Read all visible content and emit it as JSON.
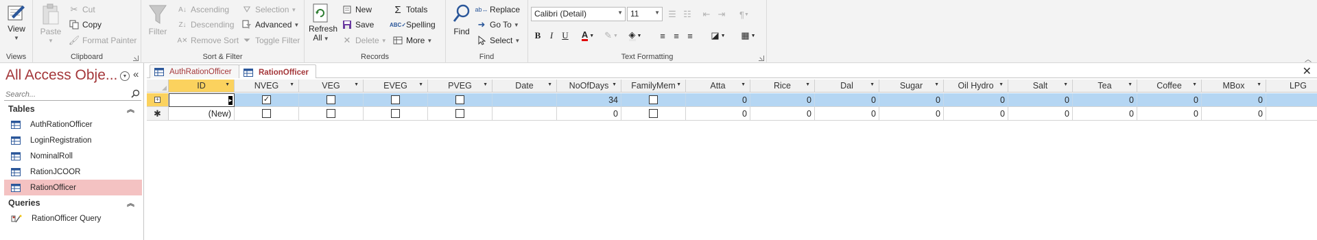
{
  "ribbon": {
    "groups": {
      "views": "Views",
      "clipboard": "Clipboard",
      "sort_filter": "Sort & Filter",
      "records": "Records",
      "find": "Find",
      "text_formatting": "Text Formatting"
    },
    "view": "View",
    "paste": "Paste",
    "cut": "Cut",
    "copy": "Copy",
    "format_painter": "Format Painter",
    "filter": "Filter",
    "ascending": "Ascending",
    "descending": "Descending",
    "remove_sort": "Remove Sort",
    "selection": "Selection",
    "advanced": "Advanced",
    "toggle_filter": "Toggle Filter",
    "refresh_all_line1": "Refresh",
    "refresh_all_line2": "All",
    "new": "New",
    "save": "Save",
    "delete": "Delete",
    "totals": "Totals",
    "spelling": "Spelling",
    "more": "More",
    "find": "Find",
    "replace": "Replace",
    "go_to": "Go To",
    "select": "Select",
    "font_name": "Calibri (Detail)",
    "font_size": "11",
    "bold": "B",
    "italic": "I",
    "underline": "U"
  },
  "nav": {
    "title": "All Access Obje...",
    "search_placeholder": "Search...",
    "sections": [
      {
        "label": "Tables",
        "items": [
          "AuthRationOfficer",
          "LoginRegistration",
          "NominalRoll",
          "RationJCOOR",
          "RationOfficer"
        ]
      },
      {
        "label": "Queries",
        "items": [
          "RationOfficer Query"
        ]
      }
    ],
    "selected_item": "RationOfficer"
  },
  "tabs": [
    "AuthRationOfficer",
    "RationOfficer"
  ],
  "active_tab": "RationOfficer",
  "datasheet": {
    "columns": [
      "ID",
      "NVEG",
      "VEG",
      "EVEG",
      "PVEG",
      "Date",
      "NoOfDays",
      "FamilyMem",
      "Atta",
      "Rice",
      "Dal",
      "Sugar",
      "Oil Hydro",
      "Salt",
      "Tea",
      "Coffee",
      "MBox",
      "LPG"
    ],
    "rows": [
      {
        "ID": "",
        "NVEG": true,
        "VEG": false,
        "EVEG": false,
        "PVEG": false,
        "Date": "",
        "NoOfDays": "34",
        "FamilyMem": false,
        "Atta": "0",
        "Rice": "0",
        "Dal": "0",
        "Sugar": "0",
        "Oil Hydro": "0",
        "Salt": "0",
        "Tea": "0",
        "Coffee": "0",
        "MBox": "0",
        "LPG": ""
      },
      {
        "ID": "(New)",
        "NVEG": false,
        "VEG": false,
        "EVEG": false,
        "PVEG": false,
        "Date": "",
        "NoOfDays": "0",
        "FamilyMem": false,
        "Atta": "0",
        "Rice": "0",
        "Dal": "0",
        "Sugar": "0",
        "Oil Hydro": "0",
        "Salt": "0",
        "Tea": "0",
        "Coffee": "0",
        "MBox": "0",
        "LPG": ""
      }
    ]
  },
  "colors": {
    "accent": "#a4373a",
    "selected_nav": "#f4c2c2",
    "selected_row": "#b5d6f3",
    "active_header": "#fbd25e"
  }
}
